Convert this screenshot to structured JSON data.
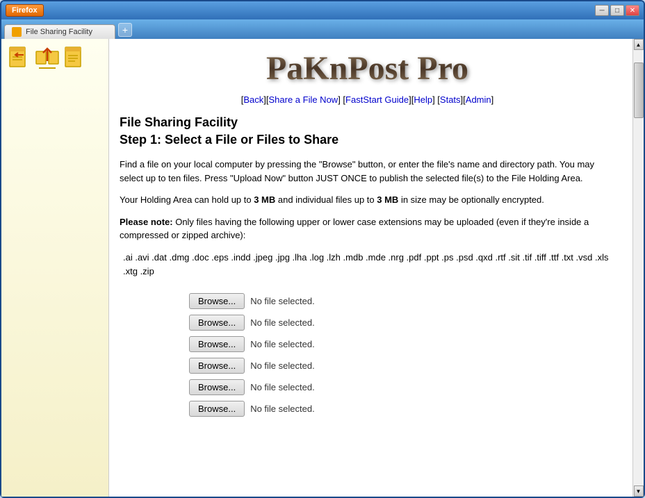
{
  "browser": {
    "firefox_label": "Firefox",
    "tab_title": "File Sharing Facility",
    "new_tab_symbol": "+",
    "win_minimize": "─",
    "win_maximize": "□",
    "win_close": "✕"
  },
  "logo": {
    "text": "PaKnPost Pro"
  },
  "nav": {
    "links": "[Back][Share a File Now] [FastStart Guide][Help] [Stats][Admin]",
    "back_label": "Back",
    "share_label": "Share a File Now",
    "faststart_label": "FastStart Guide",
    "help_label": "Help",
    "stats_label": "Stats",
    "admin_label": "Admin"
  },
  "page": {
    "title": "File Sharing Facility",
    "subtitle": "Step 1: Select a File or Files to Share",
    "description": "Find a file on your local computer by pressing the \"Browse\" button, or enter the file's name and directory path. You may select up to ten files. Press \"Upload Now\" button JUST ONCE to publish the selected file(s) to the File Holding Area.",
    "holding_area_prefix": "Your Holding Area can hold up to ",
    "holding_area_size": "3 MB",
    "holding_area_middle": " and individual files up to ",
    "individual_size": "3 MB",
    "holding_area_suffix": " in size may be optionally encrypted.",
    "please_note_label": "Please note:",
    "please_note_text": " Only files having the following upper or lower case extensions may be uploaded (even if they're inside a compressed or zipped archive):",
    "extensions": ".ai  .avi  .dat  .dmg  .doc  .eps  .indd  .jpeg  .jpg  .lha  .log  .lzh  .mdb  .mde  .nrg  .pdf  .ppt  .ps  .psd  .qxd  .rtf  .sit  .tif  .tiff  .ttf  .txt  .vsd  .xls  .xtg  .zip"
  },
  "file_inputs": [
    {
      "button_label": "Browse...",
      "status": "No file selected."
    },
    {
      "button_label": "Browse...",
      "status": "No file selected."
    },
    {
      "button_label": "Browse...",
      "status": "No file selected."
    },
    {
      "button_label": "Browse...",
      "status": "No file selected."
    },
    {
      "button_label": "Browse...",
      "status": "No file selected."
    },
    {
      "button_label": "Browse...",
      "status": "No file selected."
    }
  ]
}
